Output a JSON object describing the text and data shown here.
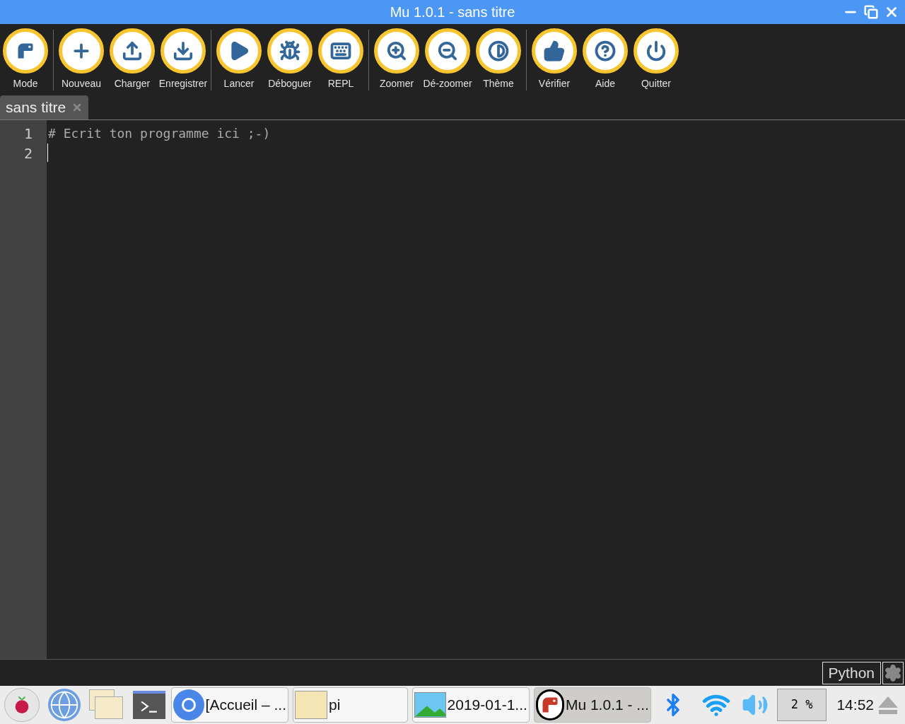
{
  "window": {
    "title": "Mu 1.0.1 - sans titre"
  },
  "toolbar": {
    "groups": [
      [
        {
          "kind": "mode",
          "label": "Mode"
        }
      ],
      [
        {
          "kind": "new",
          "label": "Nouveau"
        },
        {
          "kind": "load",
          "label": "Charger"
        },
        {
          "kind": "save",
          "label": "Enregistrer"
        }
      ],
      [
        {
          "kind": "run",
          "label": "Lancer"
        },
        {
          "kind": "debug",
          "label": "Déboguer"
        },
        {
          "kind": "repl",
          "label": "REPL"
        }
      ],
      [
        {
          "kind": "zoomin",
          "label": "Zoomer"
        },
        {
          "kind": "zoomout",
          "label": "Dé-zoomer"
        },
        {
          "kind": "theme",
          "label": "Thème"
        }
      ],
      [
        {
          "kind": "check",
          "label": "Vérifier"
        },
        {
          "kind": "help",
          "label": "Aide"
        },
        {
          "kind": "quit",
          "label": "Quitter"
        }
      ]
    ]
  },
  "tabs": [
    {
      "label": "sans titre",
      "selected": true
    }
  ],
  "editor": {
    "lines": [
      {
        "number": "1",
        "text": "# Ecrit ton programme ici ;-)"
      },
      {
        "number": "2"
      }
    ]
  },
  "status_bar": {
    "mode": "Python"
  },
  "taskbar": {
    "launchers": [
      {
        "kind": "menu"
      },
      {
        "kind": "browser"
      },
      {
        "kind": "files"
      },
      {
        "kind": "terminal"
      }
    ],
    "windows": [
      {
        "kind": "browser",
        "label": "[Accueil – ...",
        "selected": false
      },
      {
        "kind": "folder",
        "label": "pi",
        "selected": false
      },
      {
        "kind": "image",
        "label": "2019-01-1...",
        "selected": false
      },
      {
        "kind": "mu",
        "label": "Mu 1.0.1 - ...",
        "selected": true
      }
    ],
    "cpu": "2 %",
    "clock": "14:52"
  }
}
